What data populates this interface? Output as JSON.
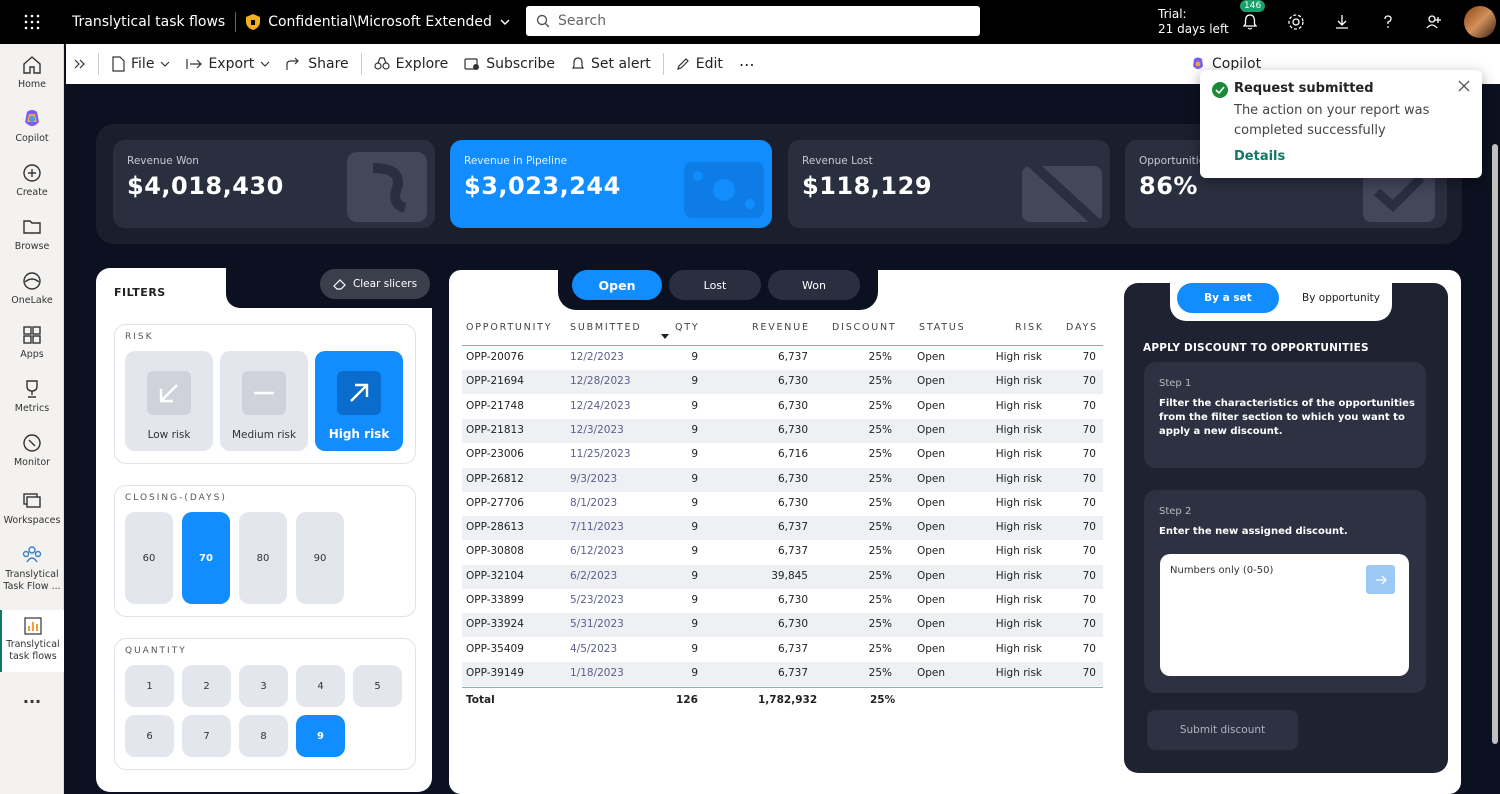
{
  "topbar": {
    "workspace": "Translytical task flows",
    "sensitivity": "Confidential\\Microsoft Extended",
    "search_placeholder": "Search",
    "trial_line1": "Trial:",
    "trial_line2": "21 days left",
    "notif_count": "146"
  },
  "nav": [
    {
      "label": "Home",
      "icon": "home-icon"
    },
    {
      "label": "Copilot",
      "icon": "copilot-icon"
    },
    {
      "label": "Create",
      "icon": "create-icon"
    },
    {
      "label": "Browse",
      "icon": "folder-icon"
    },
    {
      "label": "OneLake",
      "icon": "onelake-icon"
    },
    {
      "label": "Apps",
      "icon": "apps-icon"
    },
    {
      "label": "Metrics",
      "icon": "trophy-icon"
    },
    {
      "label": "Monitor",
      "icon": "monitor-icon"
    },
    {
      "label": "Workspaces",
      "icon": "workspaces-icon"
    },
    {
      "label": "Translytical Task Flow ...",
      "icon": "people-icon"
    },
    {
      "label": "Translytical task flows",
      "icon": "report-icon"
    },
    {
      "label": "...",
      "icon": "more-icon"
    }
  ],
  "cmdbar": {
    "file": "File",
    "export": "Export",
    "share": "Share",
    "explore": "Explore",
    "subscribe": "Subscribe",
    "set_alert": "Set alert",
    "edit": "Edit",
    "more": "⋯",
    "copilot": "Copilot"
  },
  "kpis": [
    {
      "label": "Revenue Won",
      "value": "$4,018,430",
      "icon": "dollar-ghost-icon"
    },
    {
      "label": "Revenue in Pipeline",
      "value": "$3,023,244",
      "icon": "cash-ghost-icon"
    },
    {
      "label": "Revenue Lost",
      "value": "$118,129",
      "icon": "money-off-ghost-icon"
    },
    {
      "label": "Opportunities",
      "value": "86%",
      "icon": "check-ghost-icon"
    }
  ],
  "filters": {
    "title": "FILTERS",
    "clear": "Clear slicers",
    "risk_title": "RISK",
    "risk_items": [
      {
        "label": "Low risk",
        "selected": false
      },
      {
        "label": "Medium risk",
        "selected": false
      },
      {
        "label": "High risk",
        "selected": true
      }
    ],
    "days_title": "CLOSING-(DAYS)",
    "days": [
      {
        "label": "60",
        "selected": false
      },
      {
        "label": "70",
        "selected": true
      },
      {
        "label": "80",
        "selected": false
      },
      {
        "label": "90",
        "selected": false
      }
    ],
    "qty_title": "QUANTITY",
    "qty": [
      {
        "label": "1",
        "selected": false
      },
      {
        "label": "2",
        "selected": false
      },
      {
        "label": "3",
        "selected": false
      },
      {
        "label": "4",
        "selected": false
      },
      {
        "label": "5",
        "selected": false
      },
      {
        "label": "6",
        "selected": false
      },
      {
        "label": "7",
        "selected": false
      },
      {
        "label": "8",
        "selected": false
      },
      {
        "label": "9",
        "selected": true
      }
    ]
  },
  "status_tabs": [
    {
      "label": "Open",
      "selected": true
    },
    {
      "label": "Lost",
      "selected": false
    },
    {
      "label": "Won",
      "selected": false
    }
  ],
  "table": {
    "headers": [
      "OPPORTUNITY",
      "SUBMITTED",
      "QTY",
      "REVENUE",
      "DISCOUNT",
      "STATUS",
      "RISK",
      "DAYS"
    ],
    "rows": [
      [
        "OPP-20076",
        "12/2/2023",
        "9",
        "6,737",
        "25%",
        "Open",
        "High risk",
        "70"
      ],
      [
        "OPP-21694",
        "12/28/2023",
        "9",
        "6,730",
        "25%",
        "Open",
        "High risk",
        "70"
      ],
      [
        "OPP-21748",
        "12/24/2023",
        "9",
        "6,730",
        "25%",
        "Open",
        "High risk",
        "70"
      ],
      [
        "OPP-21813",
        "12/3/2023",
        "9",
        "6,730",
        "25%",
        "Open",
        "High risk",
        "70"
      ],
      [
        "OPP-23006",
        "11/25/2023",
        "9",
        "6,716",
        "25%",
        "Open",
        "High risk",
        "70"
      ],
      [
        "OPP-26812",
        "9/3/2023",
        "9",
        "6,730",
        "25%",
        "Open",
        "High risk",
        "70"
      ],
      [
        "OPP-27706",
        "8/1/2023",
        "9",
        "6,730",
        "25%",
        "Open",
        "High risk",
        "70"
      ],
      [
        "OPP-28613",
        "7/11/2023",
        "9",
        "6,737",
        "25%",
        "Open",
        "High risk",
        "70"
      ],
      [
        "OPP-30808",
        "6/12/2023",
        "9",
        "6,737",
        "25%",
        "Open",
        "High risk",
        "70"
      ],
      [
        "OPP-32104",
        "6/2/2023",
        "9",
        "39,845",
        "25%",
        "Open",
        "High risk",
        "70"
      ],
      [
        "OPP-33899",
        "5/23/2023",
        "9",
        "6,730",
        "25%",
        "Open",
        "High risk",
        "70"
      ],
      [
        "OPP-33924",
        "5/31/2023",
        "9",
        "6,730",
        "25%",
        "Open",
        "High risk",
        "70"
      ],
      [
        "OPP-35409",
        "4/5/2023",
        "9",
        "6,737",
        "25%",
        "Open",
        "High risk",
        "70"
      ],
      [
        "OPP-39149",
        "1/18/2023",
        "9",
        "6,737",
        "25%",
        "Open",
        "High risk",
        "70"
      ]
    ],
    "total": {
      "label": "Total",
      "qty": "126",
      "revenue": "1,782,932",
      "discount": "25%"
    }
  },
  "apply": {
    "toggle_set": "By a set",
    "toggle_opp": "By opportunity",
    "title": "APPLY DISCOUNT TO OPPORTUNITIES",
    "step1_label": "Step 1",
    "step1_text": "Filter the characteristics of the opportunities from the filter section to which you want to apply a new discount.",
    "step2_label": "Step 2",
    "step2_text": "Enter the new assigned discount.",
    "input_placeholder": "Numbers only (0-50)",
    "submit": "Submit discount"
  },
  "toast": {
    "title": "Request submitted",
    "message": "The action on your report was completed successfully",
    "link": "Details"
  },
  "colors": {
    "accent": "#118dff",
    "page_bg": "#0b1120",
    "card": "#2a2f40",
    "success": "#1a8a3a"
  }
}
